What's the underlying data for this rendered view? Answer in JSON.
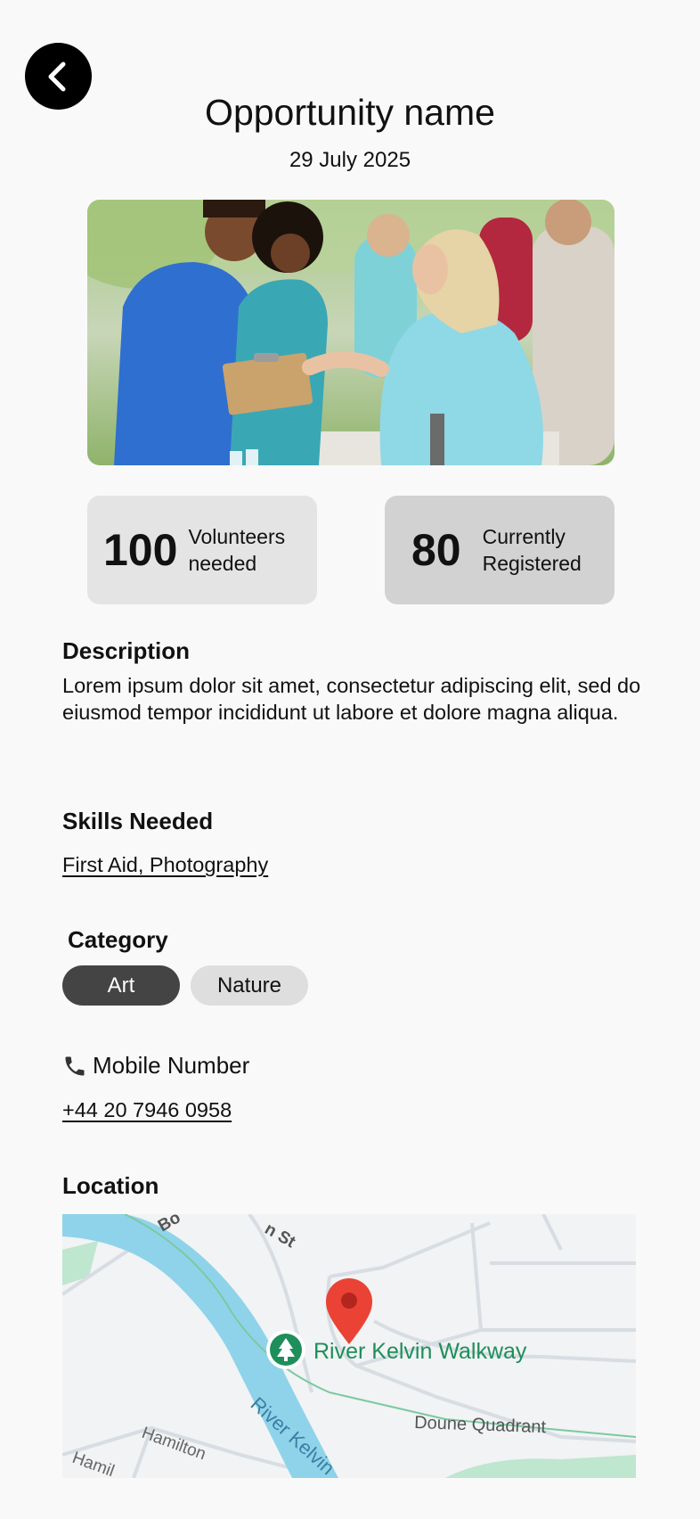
{
  "header": {
    "title": "Opportunity name",
    "date": "29 July 2025"
  },
  "stats": [
    {
      "value": "100",
      "label": "Volunteers needed"
    },
    {
      "value": "80",
      "label": "Currently Registered"
    }
  ],
  "description": {
    "heading": "Description",
    "text": "Lorem ipsum dolor sit amet, consectetur adipiscing elit, sed do eiusmod tempor incididunt ut labore et dolore magna aliqua."
  },
  "skills": {
    "heading": "Skills Needed",
    "value": "First Aid, Photography"
  },
  "category": {
    "heading": "Category",
    "chips": [
      "Art",
      "Nature"
    ]
  },
  "contact": {
    "heading": "Mobile Number",
    "phone": "+44 20 7946 0958"
  },
  "location": {
    "heading": "Location",
    "map_labels": {
      "place": "River Kelvin Walkway",
      "river": "River Kelvin",
      "street1": "Doune Quadrant",
      "street2": "Hamilton",
      "street3": "Hamil",
      "street4": "Bo",
      "street5": "n St"
    }
  },
  "colors": {
    "back_button": "#000000",
    "chip_selected": "#444444",
    "chip_unselected": "#dedede",
    "map_pin": "#ea4335",
    "map_place": "#1e8e5a",
    "river": "#8fd3ea"
  },
  "icons": {
    "back": "chevron-left-icon",
    "phone": "phone-icon",
    "pin": "map-pin-icon",
    "park": "tree-icon"
  }
}
